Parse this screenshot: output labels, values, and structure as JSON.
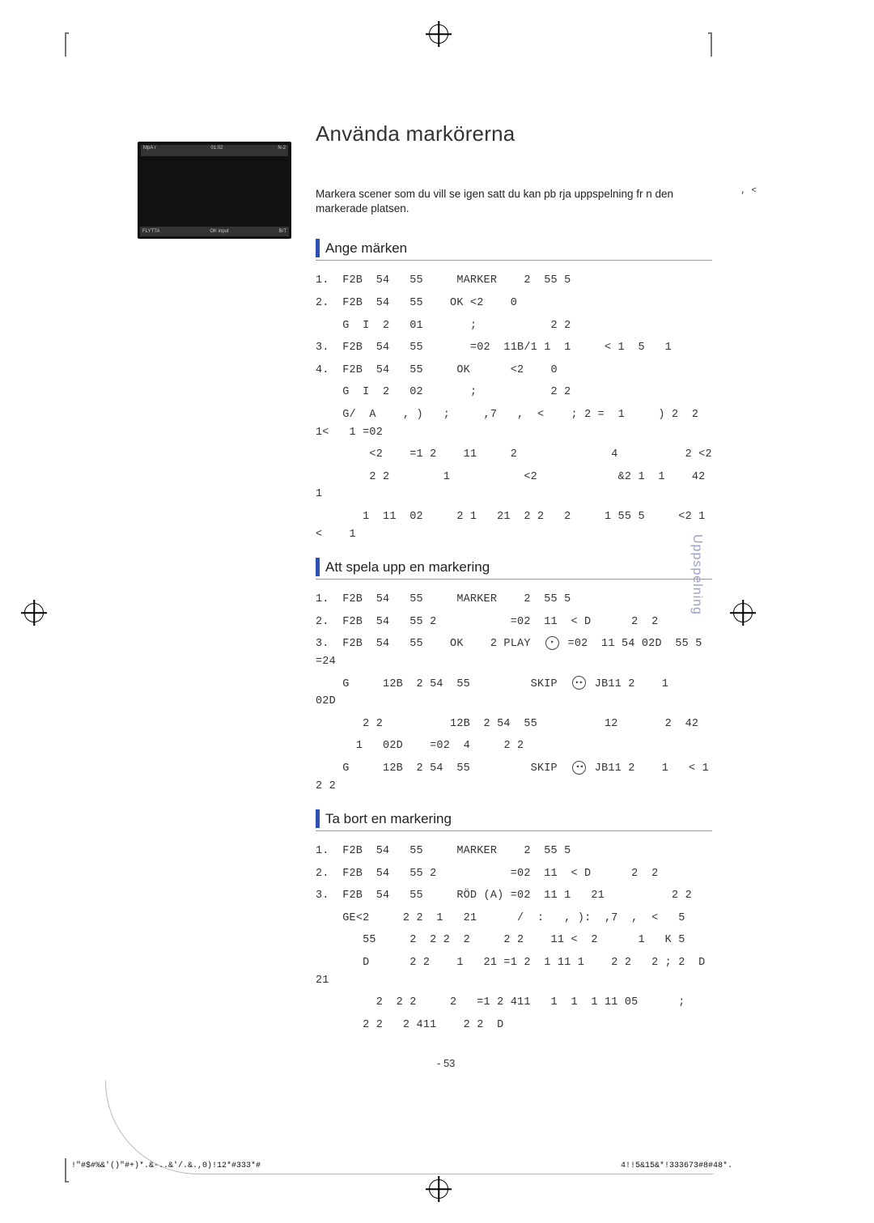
{
  "title": "Använda markörerna",
  "badge_tr": ", <",
  "intro": "Markera scener som du vill se igen satt du kan pb   rja uppspelning fr  n den markerade platsen.",
  "thumb": {
    "top_left": "MpA r",
    "top_mid": "01:02",
    "top_right": "N-2",
    "bot_left": "FLYTTA",
    "bot_mid": "OK  input",
    "bot_right": "B/T"
  },
  "sections": [
    {
      "heading": "Ange märken",
      "lines": [
        "1.  F2B  54   55     MARKER    2  55 5",
        "2.  F2B  54   55    OK <2    0",
        "    G  I  2   01       ;           2 2",
        "3.  F2B  54   55       =02  11B/1 1  1     < 1  5   1",
        "4.  F2B  54   55     OK      <2    0",
        "    G  I  2   02       ;           2 2",
        "    G/  A    , )   ;     ,7   ,  <    ; 2 =  1     ) 2  2   1<   1 =02",
        "        <2    =1 2    11     2              4          2 <2",
        "        2 2        1           <2            &2 1  1    42  1",
        "       1  11  02     2 1   21  2 2   2     1 55 5     <2 1   <    1"
      ]
    },
    {
      "heading": "Att spela upp en markering",
      "lines": [
        "1.  F2B  54   55     MARKER    2  55 5",
        "2.  F2B  54   55 2           =02  11  < D      2  2",
        "3.  F2B  54   55    OK    2 PLAY  (▶) =02  11 54 02D  55 5         =24",
        "",
        "    G     12B  2 54  55         SKIP  (▶▶) JB11 2    1    02D",
        "       2 2          12B  2 54  55          12       2  42",
        "      1   02D    =02  4     2 2",
        "    G     12B  2 54  55         SKIP  (◀◀) JB11 2    1   < 1  2 2"
      ]
    },
    {
      "heading": "Ta bort en markering",
      "lines": [
        "1.  F2B  54   55     MARKER    2  55 5",
        "2.  F2B  54   55 2           =02  11  < D      2  2",
        "3.  F2B  54   55     RÖD (A) =02  11 1   21          2 2",
        "    GE<2     2 2  1   21      /  :   , ):  ,7  ,  <   5",
        "       55     2  2 2  2     2 2    11 <  2      1   K 5",
        "       D      2 2    1   21 =1 2  1 11 1    2 2   2 ; 2  D 21",
        "         2  2 2     2   =1 2 411   1  1  1 11 05      ;",
        "       2 2   2 411    2 2  D"
      ]
    }
  ],
  "sidelabel": "Uppspelning",
  "page_number": "- 53",
  "footer_left": "!\"#$#%&'()\"#+)*.&-..&'/.&.,0)!12*#333*#",
  "footer_right": "4!!5&15&*!333673#8#48*."
}
